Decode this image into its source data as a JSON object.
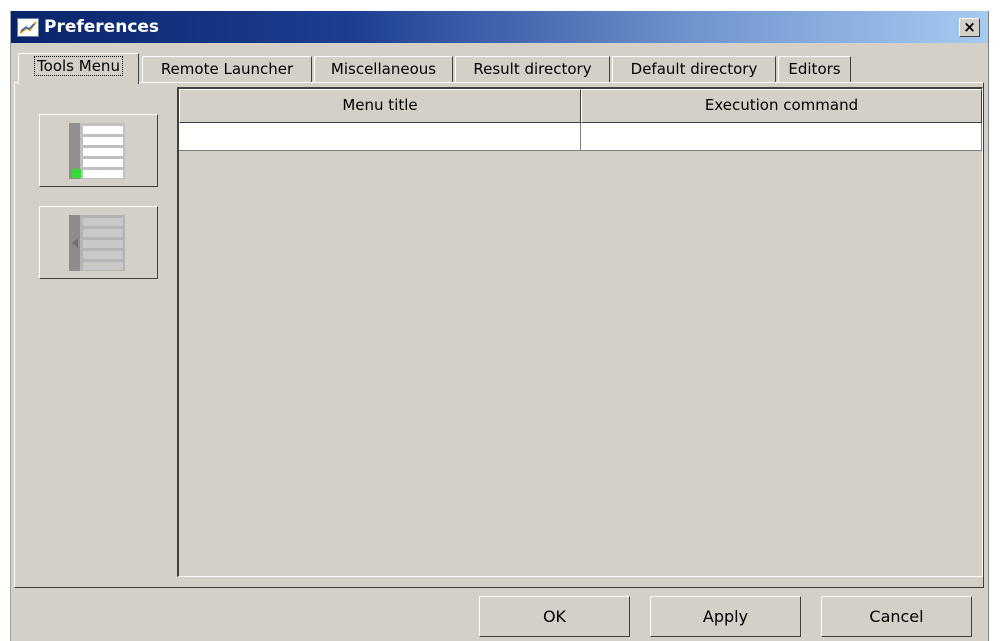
{
  "window": {
    "title": "Preferences",
    "app_icon": "preferences-app-icon",
    "close_label": "×"
  },
  "tabs": [
    {
      "label": "Tools Menu",
      "active": true
    },
    {
      "label": "Remote Launcher",
      "active": false
    },
    {
      "label": "Miscellaneous",
      "active": false
    },
    {
      "label": "Result directory",
      "active": false
    },
    {
      "label": "Default directory",
      "active": false
    },
    {
      "label": "Editors",
      "active": false
    }
  ],
  "tools_panel": {
    "add_button_icon": "add-menu-item-icon",
    "remove_button_icon": "remove-menu-item-icon",
    "table": {
      "columns": [
        "Menu title",
        "Execution command"
      ],
      "rows": [
        [
          "",
          ""
        ]
      ]
    }
  },
  "footer": {
    "ok": "OK",
    "apply": "Apply",
    "cancel": "Cancel"
  },
  "colors": {
    "title_gradient_start": "#0a246a",
    "title_gradient_end": "#a6caf0",
    "face": "#d4d0c8",
    "add_indicator": "#33dd33"
  }
}
